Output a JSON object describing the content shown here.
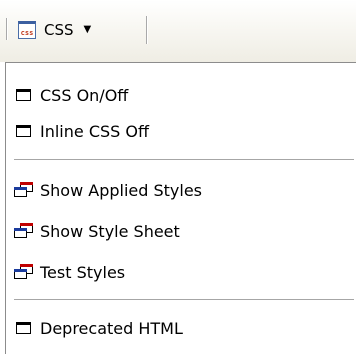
{
  "toolbar": {
    "css_button": {
      "icon_text": "css",
      "label": "CSS",
      "arrow": "▼"
    }
  },
  "menu": {
    "items": [
      {
        "label": "CSS On/Off",
        "icon": "window-icon"
      },
      {
        "label": "Inline CSS Off",
        "icon": "window-icon"
      },
      {
        "label": "Show Applied Styles",
        "icon": "cascade-windows-icon"
      },
      {
        "label": "Show Style Sheet",
        "icon": "cascade-windows-icon"
      },
      {
        "label": "Test Styles",
        "icon": "cascade-windows-icon"
      },
      {
        "label": "Deprecated HTML",
        "icon": "window-icon"
      }
    ]
  },
  "colors": {
    "toolbar_gradient_top": "#ffffff",
    "toolbar_gradient_bottom": "#efede4",
    "menu_background": "#ffffff",
    "separator": "#a6a6a6",
    "cascade_front_bar": "#1a3b9c",
    "cascade_back_bar": "#c00000",
    "css_logo_text": "#c03a1e"
  }
}
